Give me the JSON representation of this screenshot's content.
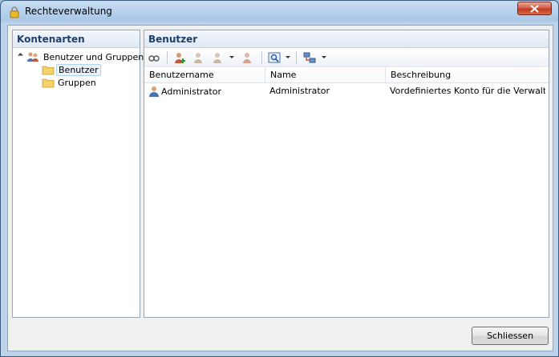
{
  "window": {
    "title": "Rechteverwaltung"
  },
  "left_panel": {
    "header": "Kontenarten",
    "tree": {
      "root": "Benutzer und Gruppen",
      "children": [
        "Benutzer",
        "Gruppen"
      ],
      "selected": "Benutzer"
    }
  },
  "right_panel": {
    "header": "Benutzer",
    "toolbar_icons": [
      "view-icon",
      "add-user-icon",
      "edit-user-icon",
      "user-properties-icon",
      "delete-user-icon",
      "search-icon",
      "network-icon"
    ],
    "columns": [
      "Benutzername",
      "Name",
      "Beschreibung"
    ],
    "rows": [
      {
        "username": "Administrator",
        "name": "Administrator",
        "description": "Vordefiniertes Konto für die Verwaltun..."
      }
    ]
  },
  "footer": {
    "close_button": "Schliessen"
  }
}
